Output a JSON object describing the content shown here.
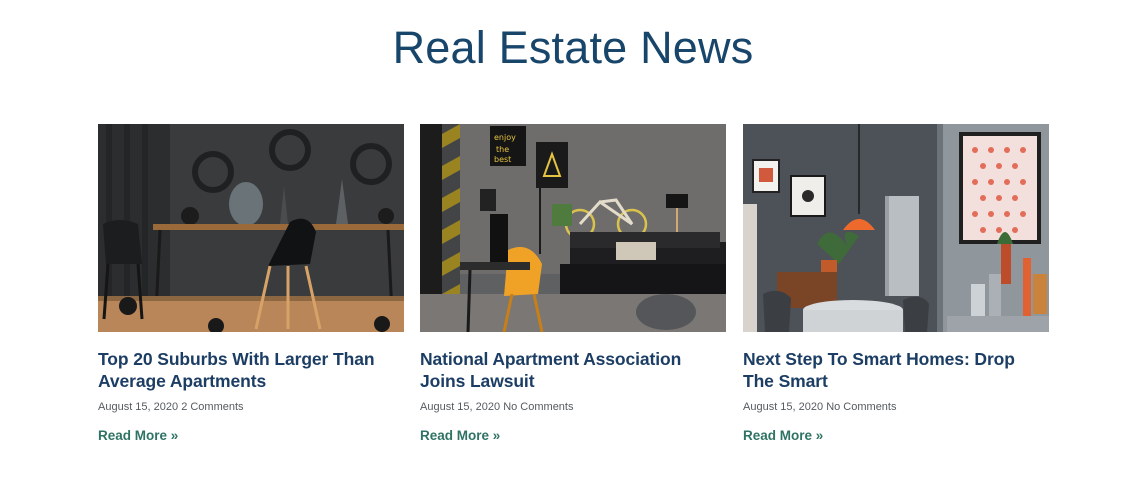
{
  "section": {
    "title": "Real Estate News"
  },
  "posts": [
    {
      "title": "Top 20 Suburbs With Larger Than Average Apartments",
      "date": "August 15, 2020",
      "comments": "2 Comments",
      "read_more": "Read More »"
    },
    {
      "title": "National Apartment Association Joins Lawsuit",
      "date": "August 15, 2020",
      "comments": "No Comments",
      "read_more": "Read More »"
    },
    {
      "title": "Next Step To Smart Homes: Drop The Smart",
      "date": "August 15, 2020",
      "comments": "No Comments",
      "read_more": "Read More »"
    }
  ],
  "colors": {
    "title": "#18456a",
    "post_title": "#1d3e64",
    "link": "#2f7364",
    "meta": "#555b60"
  }
}
